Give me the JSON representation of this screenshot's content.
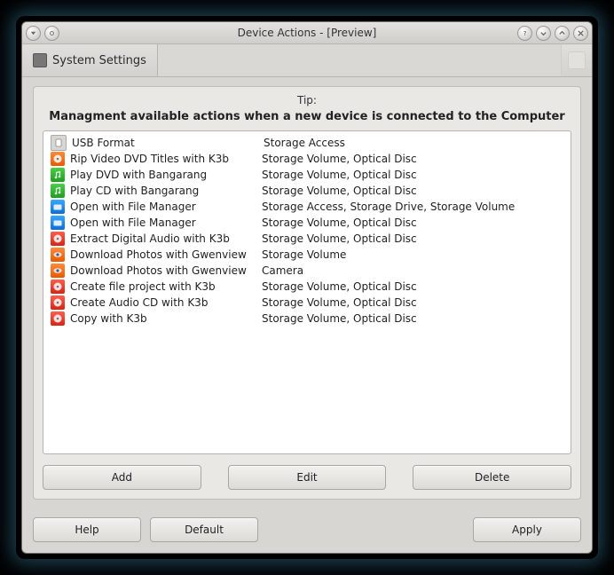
{
  "window": {
    "title": "Device Actions - [Preview]"
  },
  "toolbar": {
    "system_settings": "System Settings"
  },
  "panel": {
    "tip_label": "Tip:",
    "headline": "Managment available actions when a new device is connected to the Computer"
  },
  "actions": [
    {
      "icon": "ic-gray",
      "icon_name": "usb-drive-icon",
      "name": "USB Format",
      "desc": "Storage Access"
    },
    {
      "icon": "ic-orange",
      "icon_name": "k3b-icon",
      "name": "Rip Video DVD Titles with K3b",
      "desc": "Storage Volume, Optical Disc"
    },
    {
      "icon": "ic-green",
      "icon_name": "bangarang-icon",
      "name": "Play DVD with Bangarang",
      "desc": "Storage Volume, Optical Disc"
    },
    {
      "icon": "ic-green",
      "icon_name": "bangarang-icon",
      "name": "Play CD with Bangarang",
      "desc": "Storage Volume, Optical Disc"
    },
    {
      "icon": "ic-cyan",
      "icon_name": "file-manager-icon",
      "name": "Open with File Manager",
      "desc": "Storage Access, Storage Drive, Storage Volume"
    },
    {
      "icon": "ic-cyan",
      "icon_name": "file-manager-icon",
      "name": "Open with File Manager",
      "desc": "Storage Volume, Optical Disc"
    },
    {
      "icon": "ic-red",
      "icon_name": "k3b-icon",
      "name": "Extract Digital Audio with K3b",
      "desc": "Storage Volume, Optical Disc"
    },
    {
      "icon": "ic-orange",
      "icon_name": "gwenview-icon",
      "name": "Download Photos with Gwenview",
      "desc": "Storage Volume"
    },
    {
      "icon": "ic-orange",
      "icon_name": "gwenview-icon",
      "name": "Download Photos with Gwenview",
      "desc": "Camera"
    },
    {
      "icon": "ic-red",
      "icon_name": "k3b-icon",
      "name": "Create file project with K3b",
      "desc": "Storage Volume, Optical Disc"
    },
    {
      "icon": "ic-red",
      "icon_name": "k3b-icon",
      "name": "Create Audio CD with K3b",
      "desc": "Storage Volume, Optical Disc"
    },
    {
      "icon": "ic-red",
      "icon_name": "k3b-icon",
      "name": "Copy with K3b",
      "desc": "Storage Volume, Optical Disc"
    }
  ],
  "buttons": {
    "add": "Add",
    "edit": "Edit",
    "delete": "Delete",
    "help": "Help",
    "default": "Default",
    "apply": "Apply"
  }
}
